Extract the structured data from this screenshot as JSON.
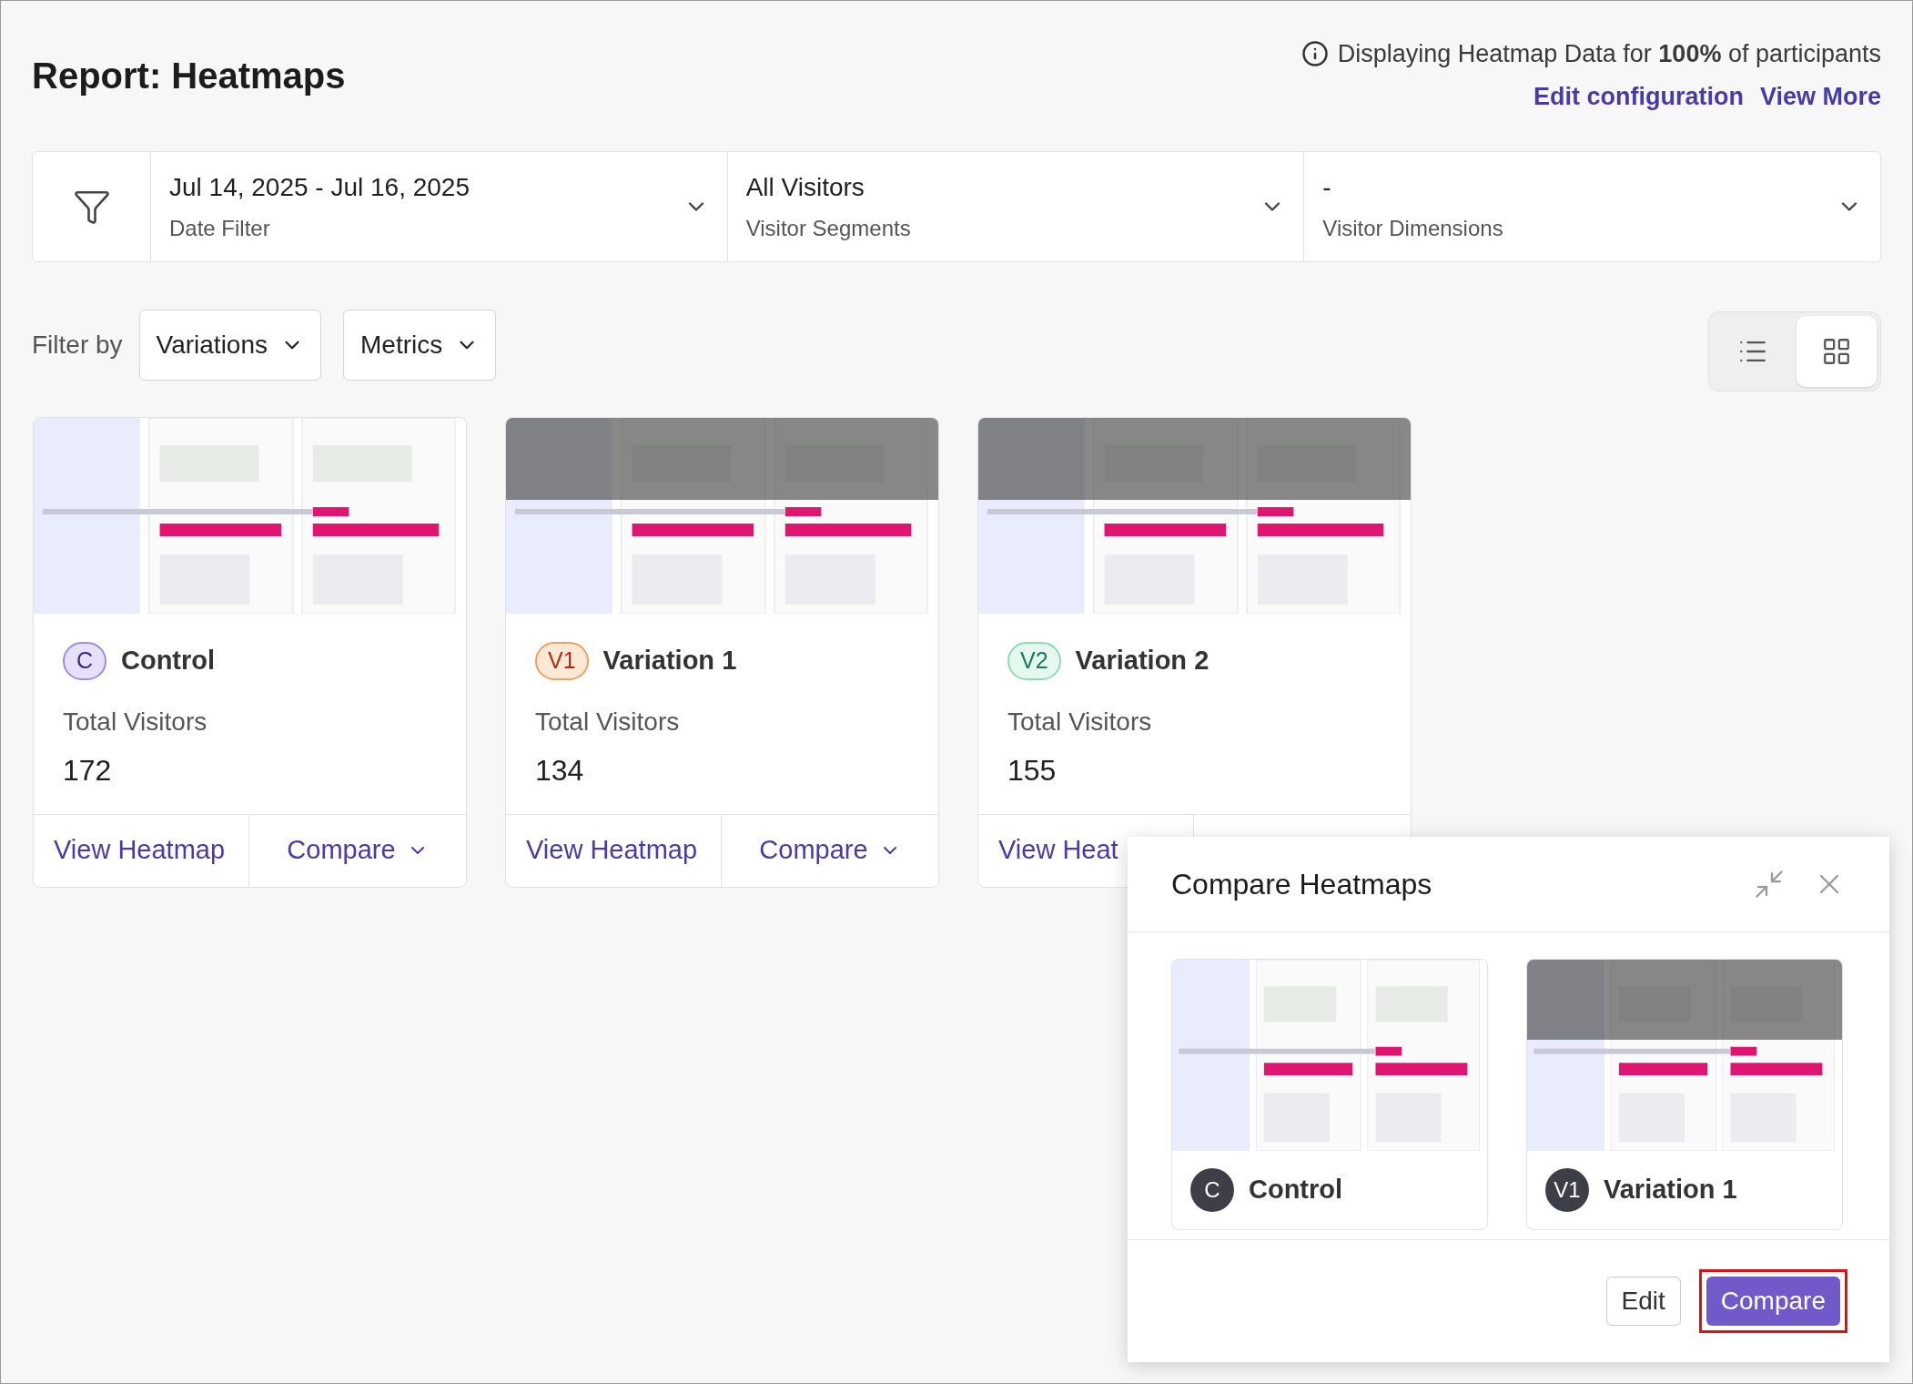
{
  "header": {
    "title": "Report: Heatmaps",
    "notice": "Displaying Heatmap Data for **100%** of participants",
    "links": [
      "Edit configuration",
      "View More"
    ]
  },
  "filters": [
    {
      "value": "Jul 14, 2025 - Jul 16, 2025",
      "label": "Date Filter"
    },
    {
      "value": "All Visitors",
      "label": "Visitor Segments"
    },
    {
      "value": "-",
      "label": "Visitor Dimensions"
    }
  ],
  "filter_by": {
    "label": "Filter by",
    "dropdowns": [
      "Variations",
      "Metrics"
    ]
  },
  "view_toggle": [
    {
      "kind": "list",
      "selected": false
    },
    {
      "kind": "grid",
      "selected": true
    }
  ],
  "cards": [
    {
      "badge": "C",
      "color": "#9b8de0",
      "name": "Control",
      "metric_label": "Total Visitors",
      "metric_value": "172",
      "actions": [
        "View Heatmap",
        "Compare"
      ]
    },
    {
      "badge": "V1",
      "color": "#f0a060",
      "name": "Variation 1",
      "metric_label": "Total Visitors",
      "metric_value": "134",
      "actions": [
        "View Heatmap",
        "Compare"
      ]
    },
    {
      "badge": "V2",
      "color": "#8fd9b5",
      "name": "Variation 2",
      "metric_label": "Total Visitors",
      "metric_value": "155",
      "actions": [
        "View Heat"
      ]
    }
  ],
  "compare_panel": {
    "title": "Compare Heatmaps",
    "items": [
      {
        "badge": "C",
        "name": "Control"
      },
      {
        "badge": "V1",
        "name": "Variation 1"
      }
    ],
    "buttons": [
      {
        "label": "Edit",
        "kind": "secondary"
      },
      {
        "label": "Compare",
        "kind": "primary",
        "highlighted": true
      }
    ]
  }
}
